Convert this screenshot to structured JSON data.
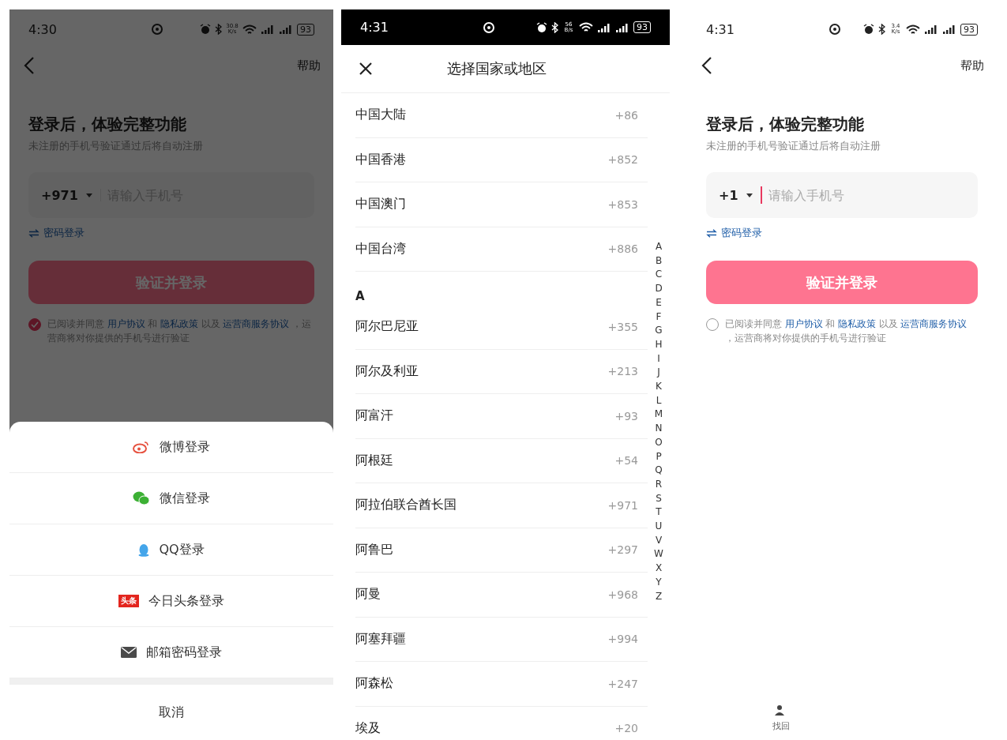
{
  "screens": [
    {
      "kind": "login",
      "dimmed": true,
      "status_bar": {
        "time": "4:30",
        "speed": "30.8",
        "speed_unit": "K/s",
        "battery": "93",
        "dark": false
      },
      "help": "帮助",
      "title": "登录后，体验完整功能",
      "subtitle": "未注册的手机号验证通过后将自动注册",
      "country_code": "+971",
      "phone_placeholder": "请输入手机号",
      "cursor": false,
      "password_login": "密码登录",
      "submit": "验证并登录",
      "agreement": {
        "checked": true,
        "parts": [
          {
            "text": "已阅读并同意 ",
            "link": false
          },
          {
            "text": "用户协议",
            "link": true
          },
          {
            "text": " 和 ",
            "link": false
          },
          {
            "text": "隐私政策",
            "link": true
          },
          {
            "text": " 以及 ",
            "link": false
          },
          {
            "text": "运营商服务协议",
            "link": true
          },
          {
            "text": " ，运营商将对你提供的手机号进行验证",
            "link": false
          }
        ]
      },
      "sheet": {
        "options": [
          {
            "kind": "weibo",
            "label": "微博登录"
          },
          {
            "kind": "wechat",
            "label": "微信登录"
          },
          {
            "kind": "qq",
            "label": "QQ登录"
          },
          {
            "kind": "toutiao",
            "label": "今日头条登录",
            "logo_text": "头条"
          },
          {
            "kind": "email",
            "label": "邮箱密码登录"
          }
        ],
        "cancel": "取消"
      }
    },
    {
      "kind": "country_picker",
      "status_bar": {
        "time": "4:31",
        "speed": "56",
        "speed_unit": "B/s",
        "battery": "93",
        "dark": true
      },
      "title": "选择国家或地区",
      "pinned": [
        {
          "name": "中国大陆",
          "code": "+86"
        },
        {
          "name": "中国香港",
          "code": "+852"
        },
        {
          "name": "中国澳门",
          "code": "+853"
        },
        {
          "name": "中国台湾",
          "code": "+886"
        }
      ],
      "sections": [
        {
          "letter": "A",
          "countries": [
            {
              "name": "阿尔巴尼亚",
              "code": "+355"
            },
            {
              "name": "阿尔及利亚",
              "code": "+213"
            },
            {
              "name": "阿富汗",
              "code": "+93"
            },
            {
              "name": "阿根廷",
              "code": "+54"
            },
            {
              "name": "阿拉伯联合酋长国",
              "code": "+971"
            },
            {
              "name": "阿鲁巴",
              "code": "+297"
            },
            {
              "name": "阿曼",
              "code": "+968"
            },
            {
              "name": "阿塞拜疆",
              "code": "+994"
            },
            {
              "name": "阿森松",
              "code": "+247"
            },
            {
              "name": "埃及",
              "code": "+20"
            }
          ]
        }
      ],
      "index": [
        "A",
        "B",
        "C",
        "D",
        "E",
        "F",
        "G",
        "H",
        "I",
        "J",
        "K",
        "L",
        "M",
        "N",
        "O",
        "P",
        "Q",
        "R",
        "S",
        "T",
        "U",
        "V",
        "W",
        "X",
        "Y",
        "Z"
      ]
    },
    {
      "kind": "login",
      "dimmed": false,
      "status_bar": {
        "time": "4:31",
        "speed": "3.4",
        "speed_unit": "K/s",
        "battery": "93",
        "dark": false
      },
      "help": "帮助",
      "title": "登录后，体验完整功能",
      "subtitle": "未注册的手机号验证通过后将自动注册",
      "country_code": "+1",
      "phone_placeholder": "请输入手机号",
      "cursor": true,
      "password_login": "密码登录",
      "submit": "验证并登录",
      "agreement": {
        "checked": false,
        "parts": [
          {
            "text": "已阅读并同意 ",
            "link": false
          },
          {
            "text": "用户协议",
            "link": true
          },
          {
            "text": " 和 ",
            "link": false
          },
          {
            "text": "隐私政策",
            "link": true
          },
          {
            "text": " 以及 ",
            "link": false
          },
          {
            "text": "运营商服务协议",
            "link": true
          },
          {
            "text": " ，运营商将对你提供的手机号进行验证",
            "link": false
          }
        ]
      },
      "footer": {
        "label": "找回"
      }
    }
  ]
}
